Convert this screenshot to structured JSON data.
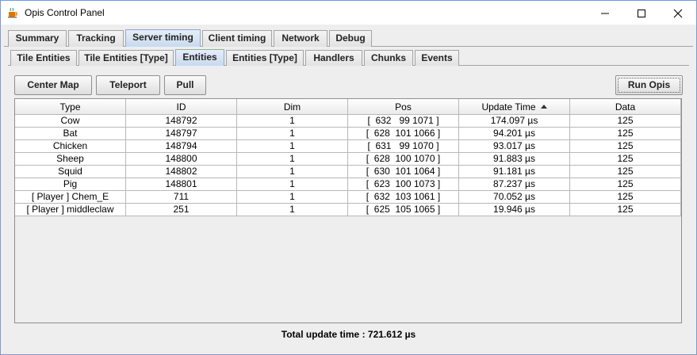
{
  "window": {
    "title": "Opis Control Panel"
  },
  "main_tabs": [
    {
      "label": "Summary",
      "selected": false
    },
    {
      "label": "Tracking",
      "selected": false
    },
    {
      "label": "Server timing",
      "selected": true
    },
    {
      "label": "Client timing",
      "selected": false
    },
    {
      "label": "Network",
      "selected": false
    },
    {
      "label": "Debug",
      "selected": false
    }
  ],
  "sub_tabs": [
    {
      "label": "Tile Entities",
      "selected": false
    },
    {
      "label": "Tile Entities [Type]",
      "selected": false
    },
    {
      "label": "Entities",
      "selected": true
    },
    {
      "label": "Entities [Type]",
      "selected": false
    },
    {
      "label": "Handlers",
      "selected": false
    },
    {
      "label": "Chunks",
      "selected": false
    },
    {
      "label": "Events",
      "selected": false
    }
  ],
  "toolbar": {
    "center_map": "Center Map",
    "teleport": "Teleport",
    "pull": "Pull",
    "run_opis": "Run Opis"
  },
  "table": {
    "columns": [
      "Type",
      "ID",
      "Dim",
      "Pos",
      "Update Time",
      "Data"
    ],
    "sorted_column": "Update Time",
    "sort_direction": "ascending-arrow",
    "rows": [
      [
        "Cow",
        "148792",
        "1",
        "[  632   99 1071 ]",
        "174.097 µs",
        "125"
      ],
      [
        "Bat",
        "148797",
        "1",
        "[  628  101 1066 ]",
        "94.201 µs",
        "125"
      ],
      [
        "Chicken",
        "148794",
        "1",
        "[  631   99 1070 ]",
        "93.017 µs",
        "125"
      ],
      [
        "Sheep",
        "148800",
        "1",
        "[  628  100 1070 ]",
        "91.883 µs",
        "125"
      ],
      [
        "Squid",
        "148802",
        "1",
        "[  630  101 1064 ]",
        "91.181 µs",
        "125"
      ],
      [
        "Pig",
        "148801",
        "1",
        "[  623  100 1073 ]",
        "87.237 µs",
        "125"
      ],
      [
        "[ Player ] Chem_E",
        "711",
        "1",
        "[  632  103 1061 ]",
        "70.052 µs",
        "125"
      ],
      [
        "[ Player ] middleclaw",
        "251",
        "1",
        "[  625  105 1065 ]",
        "19.946 µs",
        "125"
      ]
    ]
  },
  "status": {
    "total_update_time": "Total update time : 721.612 µs"
  },
  "colors": {
    "selected_tab": "#c8daee",
    "window_border": "#7a9cc6",
    "panel_bg": "#eeeeee"
  }
}
